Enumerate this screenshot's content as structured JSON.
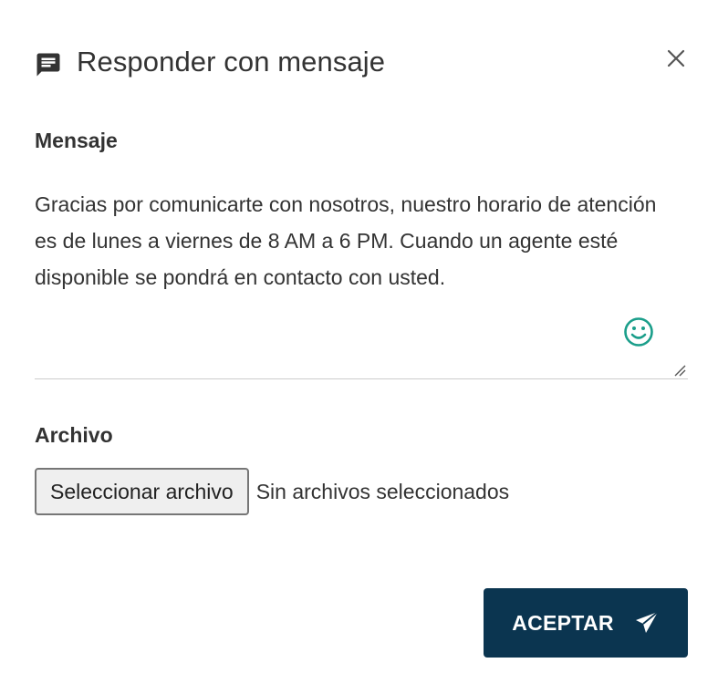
{
  "dialog": {
    "title": "Responder con mensaje",
    "icons": {
      "title_icon": "message-icon",
      "close_icon": "close-icon"
    }
  },
  "message_section": {
    "label": "Mensaje",
    "value": "Gracias por comunicarte con nosotros, nuestro horario de atención es de lunes a viernes de 8 AM a 6 PM. Cuando un agente esté disponible se pondrá en contacto con usted.",
    "emoji_icon": "smiley-icon",
    "emoji_color": "#1a9e8a"
  },
  "file_section": {
    "label": "Archivo",
    "button_label": "Seleccionar archivo",
    "status": "Sin archivos seleccionados"
  },
  "actions": {
    "accept_label": "ACEPTAR",
    "accept_icon": "send-icon",
    "accept_color": "#0b3550"
  }
}
